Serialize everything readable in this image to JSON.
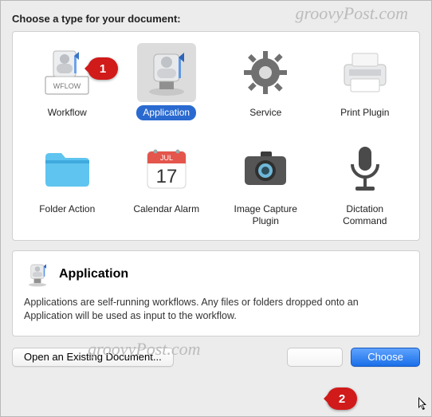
{
  "prompt": "Choose a type for your document:",
  "types": [
    {
      "label": "Workflow",
      "icon": "robot-wflow",
      "selected": false
    },
    {
      "label": "Application",
      "icon": "robot-app",
      "selected": true
    },
    {
      "label": "Service",
      "icon": "gear",
      "selected": false
    },
    {
      "label": "Print Plugin",
      "icon": "printer",
      "selected": false
    },
    {
      "label": "Folder Action",
      "icon": "folder",
      "selected": false
    },
    {
      "label": "Calendar Alarm",
      "icon": "calendar",
      "selected": false
    },
    {
      "label": "Image Capture Plugin",
      "icon": "camera",
      "selected": false
    },
    {
      "label": "Dictation Command",
      "icon": "microphone",
      "selected": false
    }
  ],
  "description": {
    "title": "Application",
    "text": "Applications are self-running workflows. Any files or folders dropped onto an Application will be used as input to the workflow."
  },
  "buttons": {
    "open_existing": "Open an Existing Document...",
    "close": "",
    "choose": "Choose"
  },
  "annotations": {
    "marker1": "1",
    "marker2": "2"
  },
  "watermark": "groovyPost.com",
  "calendar_icon": {
    "month": "JUL",
    "day": "17"
  },
  "wflow_text": "WFLOW"
}
